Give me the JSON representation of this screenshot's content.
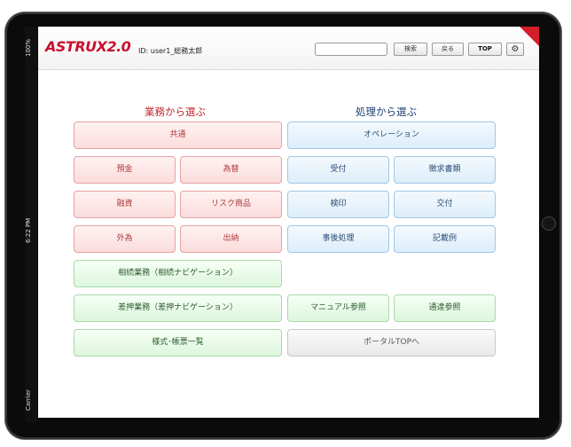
{
  "status_bar": {
    "battery": "100%",
    "time": "6:22 PM",
    "carrier": "Carrier"
  },
  "header": {
    "logo": "ASTRUX2.0",
    "user_label": "ID: user1_総務太郎",
    "search_value": "",
    "search_button": "検索",
    "back_button": "戻る",
    "top_button": "TOP",
    "settings_icon": "gear-icon"
  },
  "left": {
    "heading": "業務から選ぶ",
    "common": "共通",
    "deposit": "預金",
    "exchange": "為替",
    "loan": "融資",
    "risk_products": "リスク商品",
    "foreign_exchange": "外為",
    "cashier": "出納",
    "inheritance": "相続業務（相続ナビゲーション）",
    "seizure": "差押業務（差押ナビゲーション）",
    "forms": "様式･帳票一覧"
  },
  "right": {
    "heading": "処理から選ぶ",
    "operation": "オペレーション",
    "reception": "受付",
    "documents": "徴求書類",
    "verification": "検印",
    "delivery": "交付",
    "post_processing": "事後処理",
    "examples": "記載例",
    "manual": "マニュアル参照",
    "notices": "通達参照",
    "portal": "ポータルTOPへ"
  },
  "colors": {
    "brand_red": "#c8102e",
    "pink_button": "#fbdcdc",
    "blue_button": "#ddeefa",
    "green_button": "#ddf6dd",
    "gray_button": "#e9e9e9"
  }
}
